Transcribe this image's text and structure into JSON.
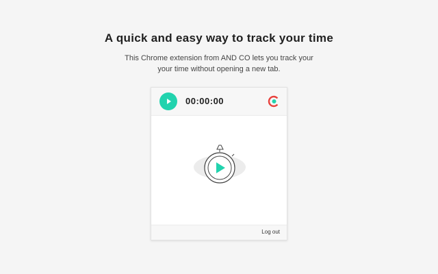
{
  "header": {
    "title": "A quick and easy way to track your time",
    "subtitle_line1": "This Chrome extension from AND CO lets you track your",
    "subtitle_line2": "your time without opening a new tab."
  },
  "popup": {
    "timer_value": "00:00:00",
    "logout_label": "Log out",
    "play_icon": "play-icon",
    "logo_icon": "andco-logo-icon",
    "illustration_icon": "stopwatch-play-icon"
  },
  "colors": {
    "accent": "#22d3ae",
    "logo_red": "#e8413c",
    "logo_green": "#22d3ae",
    "background": "#f5f5f5"
  }
}
